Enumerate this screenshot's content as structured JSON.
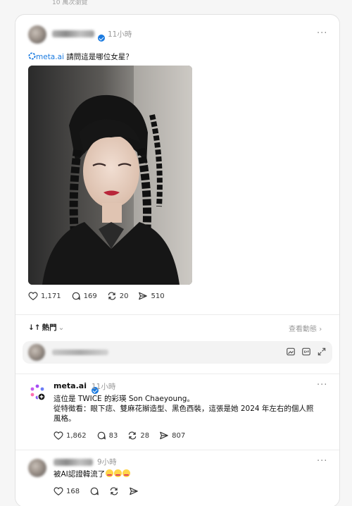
{
  "top_caption": "10 萬次瀏覽",
  "post": {
    "time": "11小時",
    "more": "···",
    "mention": "meta.ai",
    "text": " 請問這是哪位女星？",
    "likes": "1,171",
    "comments": "169",
    "reposts": "20",
    "shares": "510"
  },
  "sort": {
    "label": "熱門",
    "view_activity": "查看動態"
  },
  "reply_reply": {
    "name": "meta.ai",
    "time": "11小時",
    "more": "···",
    "line1": "這位是 TWICE 的彩瑛 Son Chaeyoung。",
    "line2": "從特徵看：眼下痣、雙麻花辮造型、黑色西裝，這張是她 2024 年左右的個人照",
    "line3": "風格。",
    "likes": "1,862",
    "comments": "83",
    "reposts": "28",
    "shares": "807"
  },
  "comment": {
    "time": "9小時",
    "more": "···",
    "text": "被AI認證韓流了",
    "likes": "168"
  },
  "colors": {
    "link": "#1a7ae0",
    "muted": "#999999",
    "meta_gradient": [
      "#a64bf4",
      "#3b82f6",
      "#ff6fb1"
    ]
  },
  "icons": [
    "heart-icon",
    "comment-icon",
    "repost-icon",
    "share-icon",
    "more-icon",
    "verified-icon",
    "meta-ai-icon",
    "gif-icon",
    "image-icon",
    "expand-icon",
    "sort-icon",
    "chevron-down-icon"
  ]
}
